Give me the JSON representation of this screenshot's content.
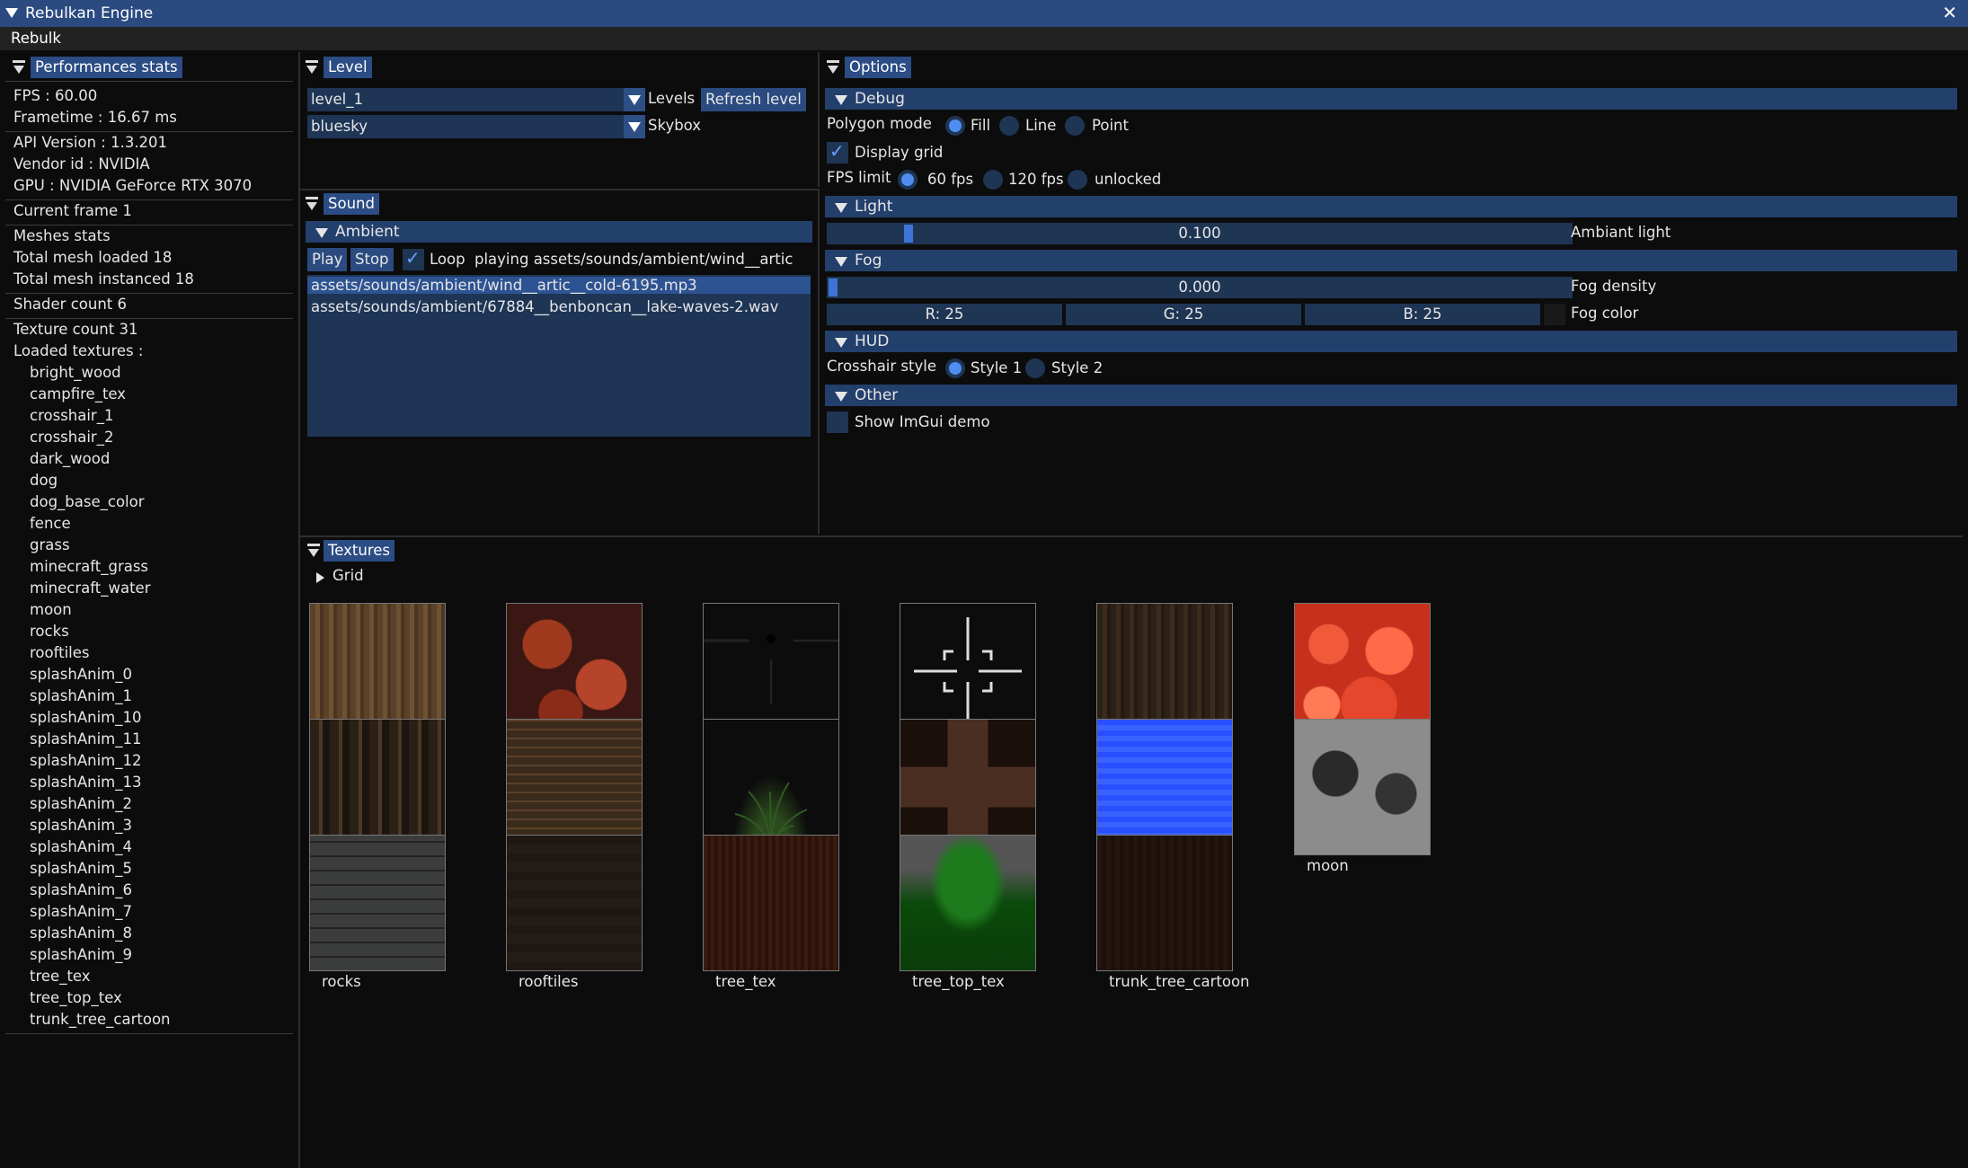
{
  "window": {
    "title": "Rebulkan Engine",
    "close_glyph": "✕",
    "menu": "Rebulk"
  },
  "perf": {
    "header": "Performances stats",
    "fps": "FPS : 60.00",
    "frametime": "Frametime : 16.67 ms",
    "api": "API Version : 1.3.201",
    "vendor": "Vendor id : NVIDIA",
    "gpu": "GPU : NVIDIA GeForce RTX 3070",
    "frame": "Current frame 1",
    "meshes": "Meshes stats",
    "loaded": "Total mesh loaded 18",
    "instanced": "Total mesh instanced 18",
    "shaders": "Shader count 6",
    "textures": "Texture count 31",
    "loaded_textures": "Loaded textures :",
    "texture_names": [
      "bright_wood",
      "campfire_tex",
      "crosshair_1",
      "crosshair_2",
      "dark_wood",
      "dog",
      "dog_base_color",
      "fence",
      "grass",
      "minecraft_grass",
      "minecraft_water",
      "moon",
      "rocks",
      "rooftiles",
      "splashAnim_0",
      "splashAnim_1",
      "splashAnim_10",
      "splashAnim_11",
      "splashAnim_12",
      "splashAnim_13",
      "splashAnim_2",
      "splashAnim_3",
      "splashAnim_4",
      "splashAnim_5",
      "splashAnim_6",
      "splashAnim_7",
      "splashAnim_8",
      "splashAnim_9",
      "tree_tex",
      "tree_top_tex",
      "trunk_tree_cartoon"
    ]
  },
  "level": {
    "header": "Level",
    "level_value": "level_1",
    "levels_label": "Levels",
    "refresh": "Refresh level",
    "skybox_value": "bluesky",
    "skybox_label": "Skybox"
  },
  "sound": {
    "header": "Sound",
    "ambient": "Ambient",
    "play": "Play",
    "stop": "Stop",
    "loop": "Loop",
    "loop_checked": true,
    "playing": "playing assets/sounds/ambient/wind__artic",
    "files": [
      "assets/sounds/ambient/wind__artic__cold-6195.mp3",
      "assets/sounds/ambient/67884__benboncan__lake-waves-2.wav"
    ]
  },
  "options": {
    "header": "Options",
    "debug": "Debug",
    "polygon_mode": "Polygon mode",
    "polygon_options": [
      "Fill",
      "Line",
      "Point"
    ],
    "polygon_selected": "Fill",
    "display_grid": "Display grid",
    "display_grid_checked": true,
    "fps_limit": "FPS limit",
    "fps_options": [
      "60 fps",
      "120 fps",
      "unlocked"
    ],
    "fps_selected": "60 fps",
    "light": "Light",
    "ambient_value": "0.100",
    "ambient_fraction": 0.1,
    "ambient_label": "Ambiant light",
    "fog": "Fog",
    "fog_value": "0.000",
    "fog_fraction": 0.0,
    "fog_density_label": "Fog density",
    "fog_r": "R: 25",
    "fog_g": "G: 25",
    "fog_b": "B: 25",
    "fog_color_label": "Fog color",
    "fog_swatch": "#191919",
    "hud": "HUD",
    "crosshair_style": "Crosshair style",
    "crosshair_options": [
      "Style 1",
      "Style 2"
    ],
    "crosshair_selected": "Style 1",
    "other": "Other",
    "show_demo": "Show ImGui demo",
    "show_demo_checked": false
  },
  "textures": {
    "header": "Textures",
    "grid": "Grid",
    "items": [
      {
        "name": "bright_wood",
        "style": "wood-light"
      },
      {
        "name": "campfire_tex",
        "style": "campfire"
      },
      {
        "name": "crosshair_1",
        "style": "crosshair1"
      },
      {
        "name": "crosshair_2",
        "style": "crosshair2"
      },
      {
        "name": "dark_wood",
        "style": "wood-dark"
      },
      {
        "name": "dog",
        "style": "dog"
      },
      {
        "name": "dog_base_color",
        "style": "dogbase"
      },
      {
        "name": "fence",
        "style": "fence"
      },
      {
        "name": "grass",
        "style": "grass"
      },
      {
        "name": "minecraft_grass",
        "style": "mcgrass"
      },
      {
        "name": "minecraft_water",
        "style": "mcwater"
      },
      {
        "name": "moon",
        "style": "moon"
      },
      {
        "name": "rocks",
        "style": "rocks"
      },
      {
        "name": "rooftiles",
        "style": "rooftiles"
      },
      {
        "name": "tree_tex",
        "style": "treetex"
      },
      {
        "name": "tree_top_tex",
        "style": "treetop"
      },
      {
        "name": "trunk_tree_cartoon",
        "style": "trunk"
      }
    ]
  },
  "colors": {
    "title": "#2a4a80",
    "header": "#233f6c",
    "frame": "#1f3554",
    "accent": "#4f8ef0"
  }
}
